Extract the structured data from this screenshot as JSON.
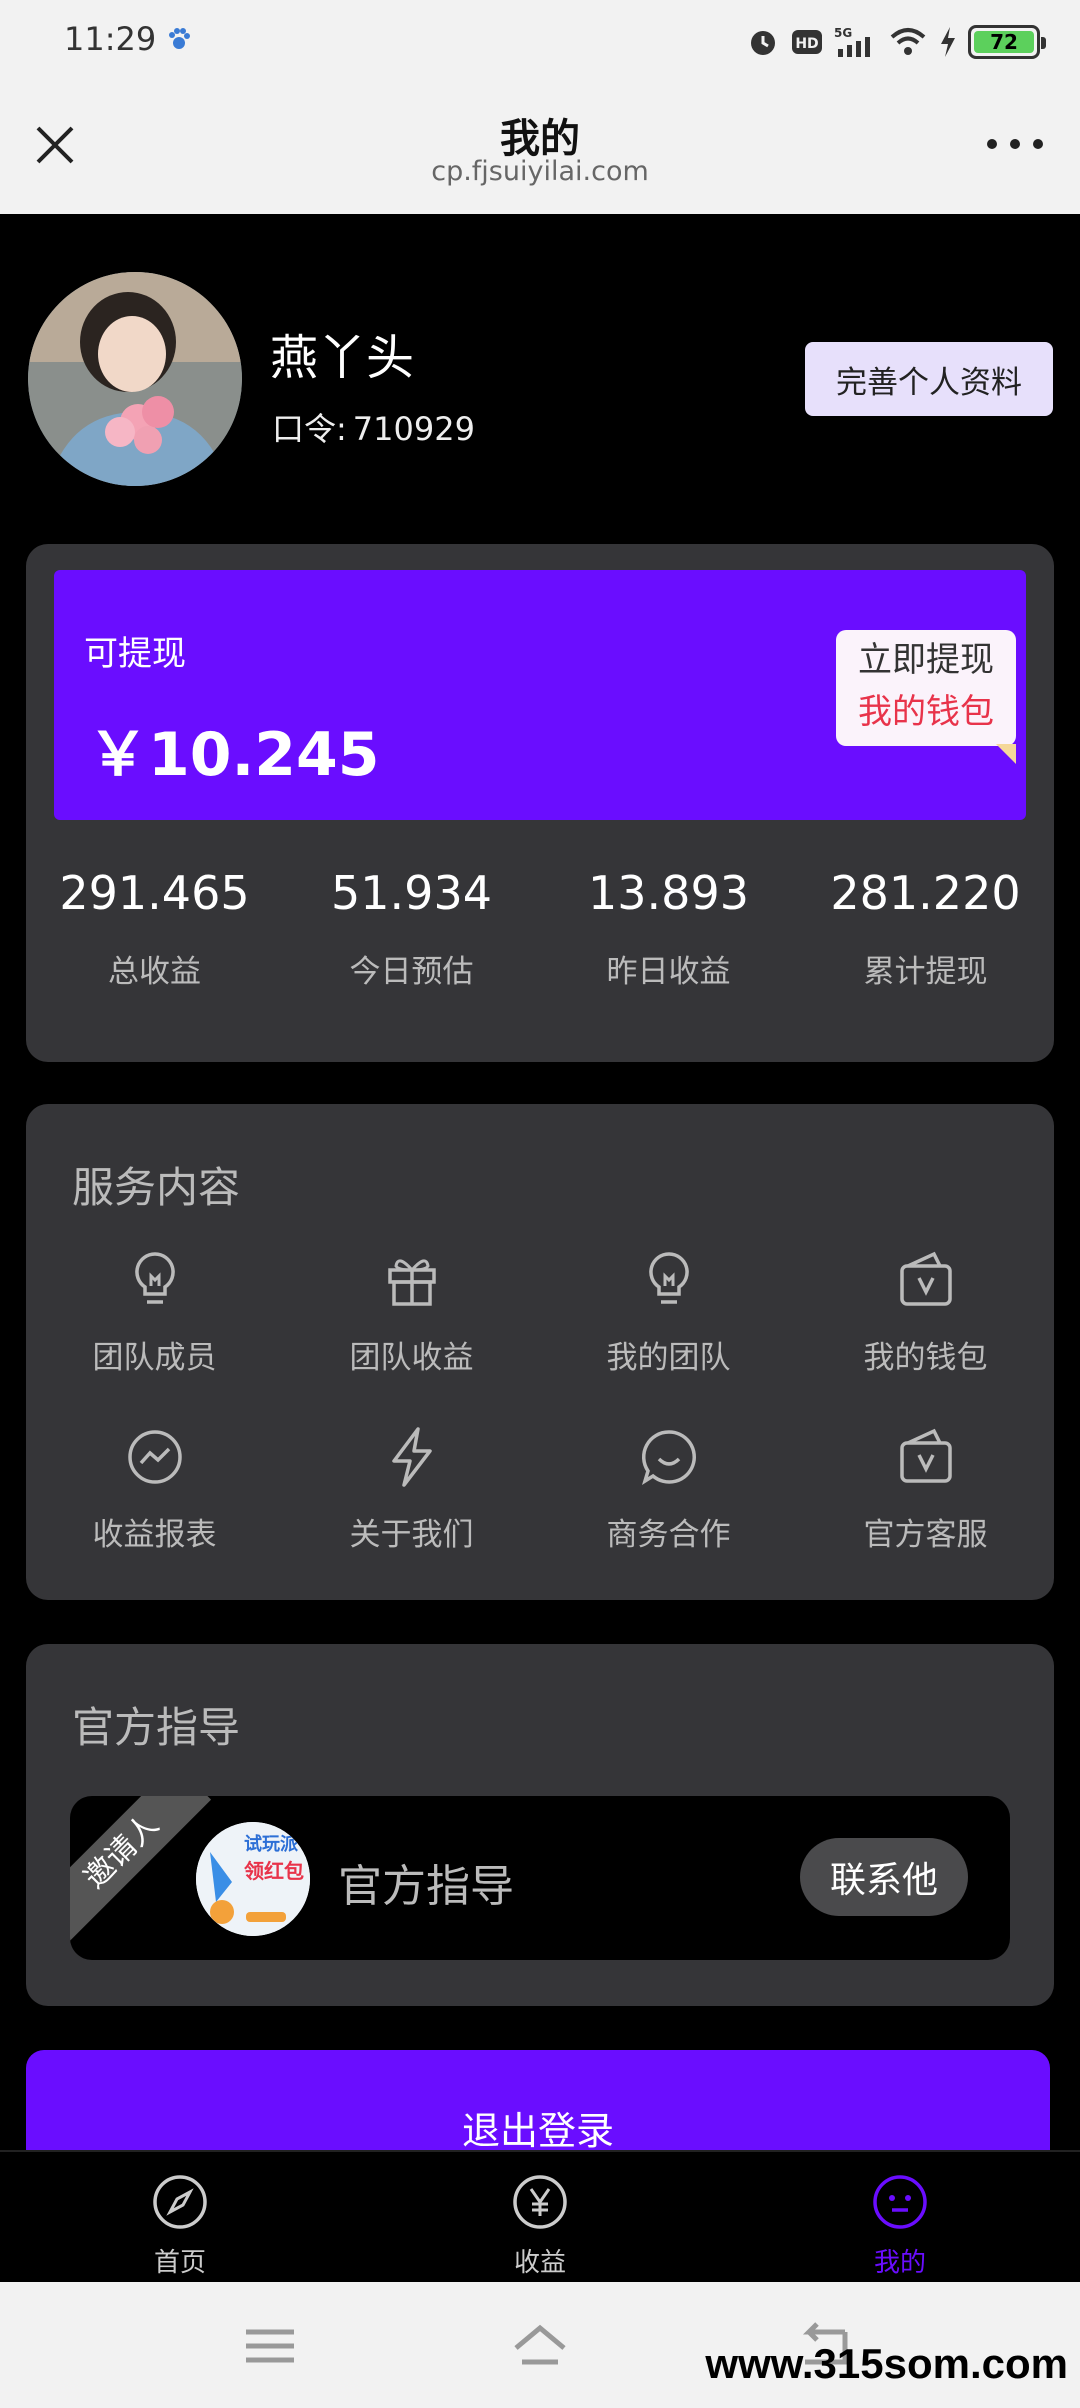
{
  "status_bar": {
    "time": "11:29",
    "network": "5G",
    "battery": "72"
  },
  "title_bar": {
    "title": "我的",
    "url": "cp.fjsuiyilai.com"
  },
  "profile": {
    "username": "燕丫头",
    "code_label": "口令:",
    "code_value": "710929",
    "edit_button": "完善个人资料"
  },
  "balance": {
    "label": "可提现",
    "amount": "￥10.245",
    "withdraw_line1": "立即提现",
    "withdraw_line2": "我的钱包"
  },
  "stats": [
    {
      "value": "291.465",
      "caption": "总收益"
    },
    {
      "value": "51.934",
      "caption": "今日预估"
    },
    {
      "value": "13.893",
      "caption": "昨日收益"
    },
    {
      "value": "281.220",
      "caption": "累计提现"
    }
  ],
  "services": {
    "title": "服务内容",
    "items": [
      {
        "label": "团队成员",
        "icon": "lightbulb-icon"
      },
      {
        "label": "团队收益",
        "icon": "gift-icon"
      },
      {
        "label": "我的团队",
        "icon": "lightbulb-icon"
      },
      {
        "label": "我的钱包",
        "icon": "wallet-icon"
      },
      {
        "label": "收益报表",
        "icon": "chart-circle-icon"
      },
      {
        "label": "关于我们",
        "icon": "lightning-icon"
      },
      {
        "label": "商务合作",
        "icon": "chat-icon"
      },
      {
        "label": "官方客服",
        "icon": "wallet-icon"
      }
    ]
  },
  "guide": {
    "title": "官方指导",
    "ribbon": "邀请人",
    "name": "官方指导",
    "contact_button": "联系他",
    "avatar_text_1": "试玩派",
    "avatar_text_2": "领红包"
  },
  "logout_button": "退出登录",
  "tabs": [
    {
      "label": "首页",
      "icon": "compass-icon"
    },
    {
      "label": "收益",
      "icon": "yen-icon"
    },
    {
      "label": "我的",
      "icon": "smiley-icon"
    }
  ],
  "colors": {
    "accent": "#6a0dff",
    "card": "#353538",
    "withdraw_red": "#e8334a"
  },
  "watermark": "www.315som.com"
}
